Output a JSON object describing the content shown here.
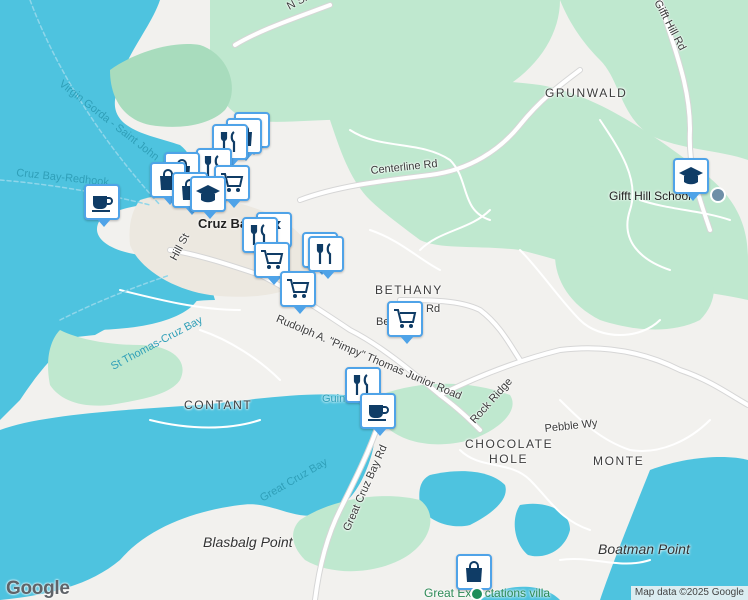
{
  "map": {
    "colors": {
      "water": "#4ec3df",
      "land": "#f2f1ee",
      "park": "#bfe8cf",
      "park_dark": "#a8dcbd",
      "road": "#ffffff",
      "road_outline": "#d6d6d6",
      "pin_border": "#4fa3e8",
      "pin_icon": "#0f3c66"
    },
    "area_labels": {
      "grunwald": "GRUNWALD",
      "bethany": "BETHANY",
      "contant": "CONTANT",
      "chocolate": "CHOCOLATE",
      "hole": "HOLE",
      "monte": "MONTE"
    },
    "point_labels": {
      "blasbalg": "Blasbalg Point",
      "boatman": "Boatman Point"
    },
    "place_labels": {
      "cruz_bay": "Cruz Ba",
      "gifft_hill_school": "Gifft Hill School",
      "great_expectations": "Great Expectations villa",
      "guin": "Guin"
    },
    "road_labels": {
      "n_shore": "N Sho",
      "gifft_hill_rd": "Gifft Hill Rd",
      "centerline_rd": "Centerline Rd",
      "hill_st": "Hill St",
      "bethany_rd_a": "Be",
      "bethany_rd_b": "Rd",
      "rudolph": "Rudolph A. \"Pimpy\" Thomas Junior Road",
      "rock_ridge": "Rock Ridge",
      "pebble_wy": "Pebble Wy",
      "great_cruz_bay_rd": "Great Cruz Bay Rd"
    },
    "water_labels": {
      "virgin_gorda": "Virgin Gorda - Saint John",
      "cruz_bay_redhook": "Cruz Bay-Redhook",
      "st_thomas_cruz_bay": "St Thomas-Cruz Bay",
      "great_cruz_bay": "Great Cruz Bay"
    },
    "markers": [
      {
        "type": "restaurant-icon"
      },
      {
        "type": "shopping-bag-icon"
      },
      {
        "type": "cafe-icon"
      },
      {
        "type": "grocery-cart-icon"
      },
      {
        "type": "school-icon"
      },
      {
        "type": "flag-icon"
      }
    ],
    "attribution": "Map data ©2025 Google",
    "logo": "Google"
  }
}
